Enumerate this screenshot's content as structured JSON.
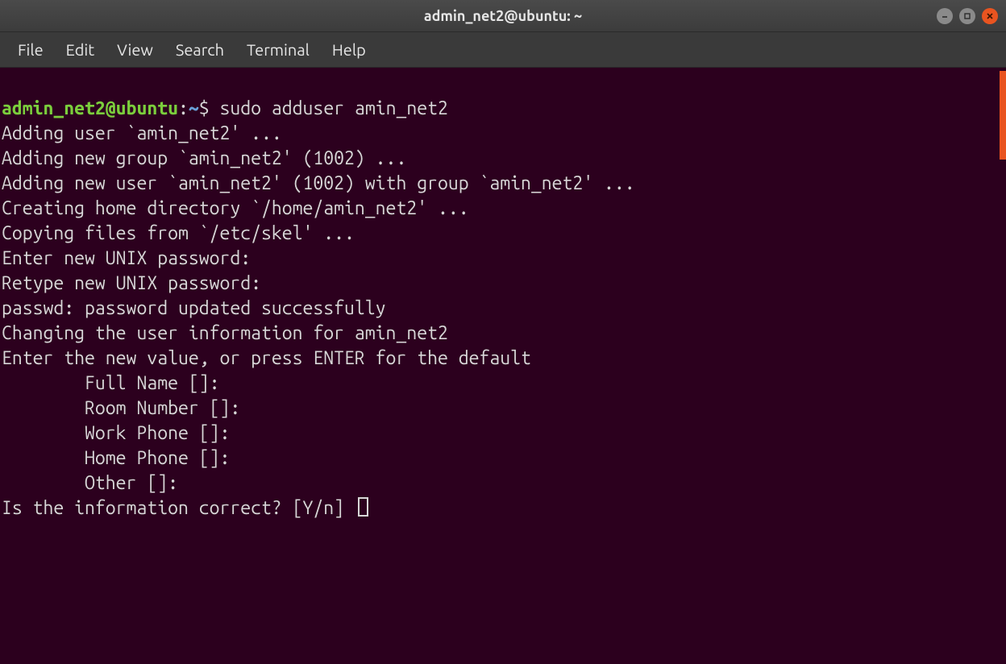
{
  "window": {
    "title": "admin_net2@ubuntu: ~"
  },
  "menu": {
    "file": "File",
    "edit": "Edit",
    "view": "View",
    "search": "Search",
    "terminal": "Terminal",
    "help": "Help"
  },
  "prompt": {
    "userhost": "admin_net2@ubuntu",
    "sep": ":",
    "path": "~",
    "dollar": "$ "
  },
  "command": "sudo adduser amin_net2",
  "output": {
    "l1": "Adding user `amin_net2' ...",
    "l2": "Adding new group `amin_net2' (1002) ...",
    "l3": "Adding new user `amin_net2' (1002) with group `amin_net2' ...",
    "l4": "Creating home directory `/home/amin_net2' ...",
    "l5": "Copying files from `/etc/skel' ...",
    "l6": "Enter new UNIX password: ",
    "l7": "Retype new UNIX password: ",
    "l8": "passwd: password updated successfully",
    "l9": "Changing the user information for amin_net2",
    "l10": "Enter the new value, or press ENTER for the default",
    "l11": "        Full Name []: ",
    "l12": "        Room Number []: ",
    "l13": "        Work Phone []: ",
    "l14": "        Home Phone []: ",
    "l15": "        Other []: ",
    "l16": "Is the information correct? [Y/n] "
  }
}
